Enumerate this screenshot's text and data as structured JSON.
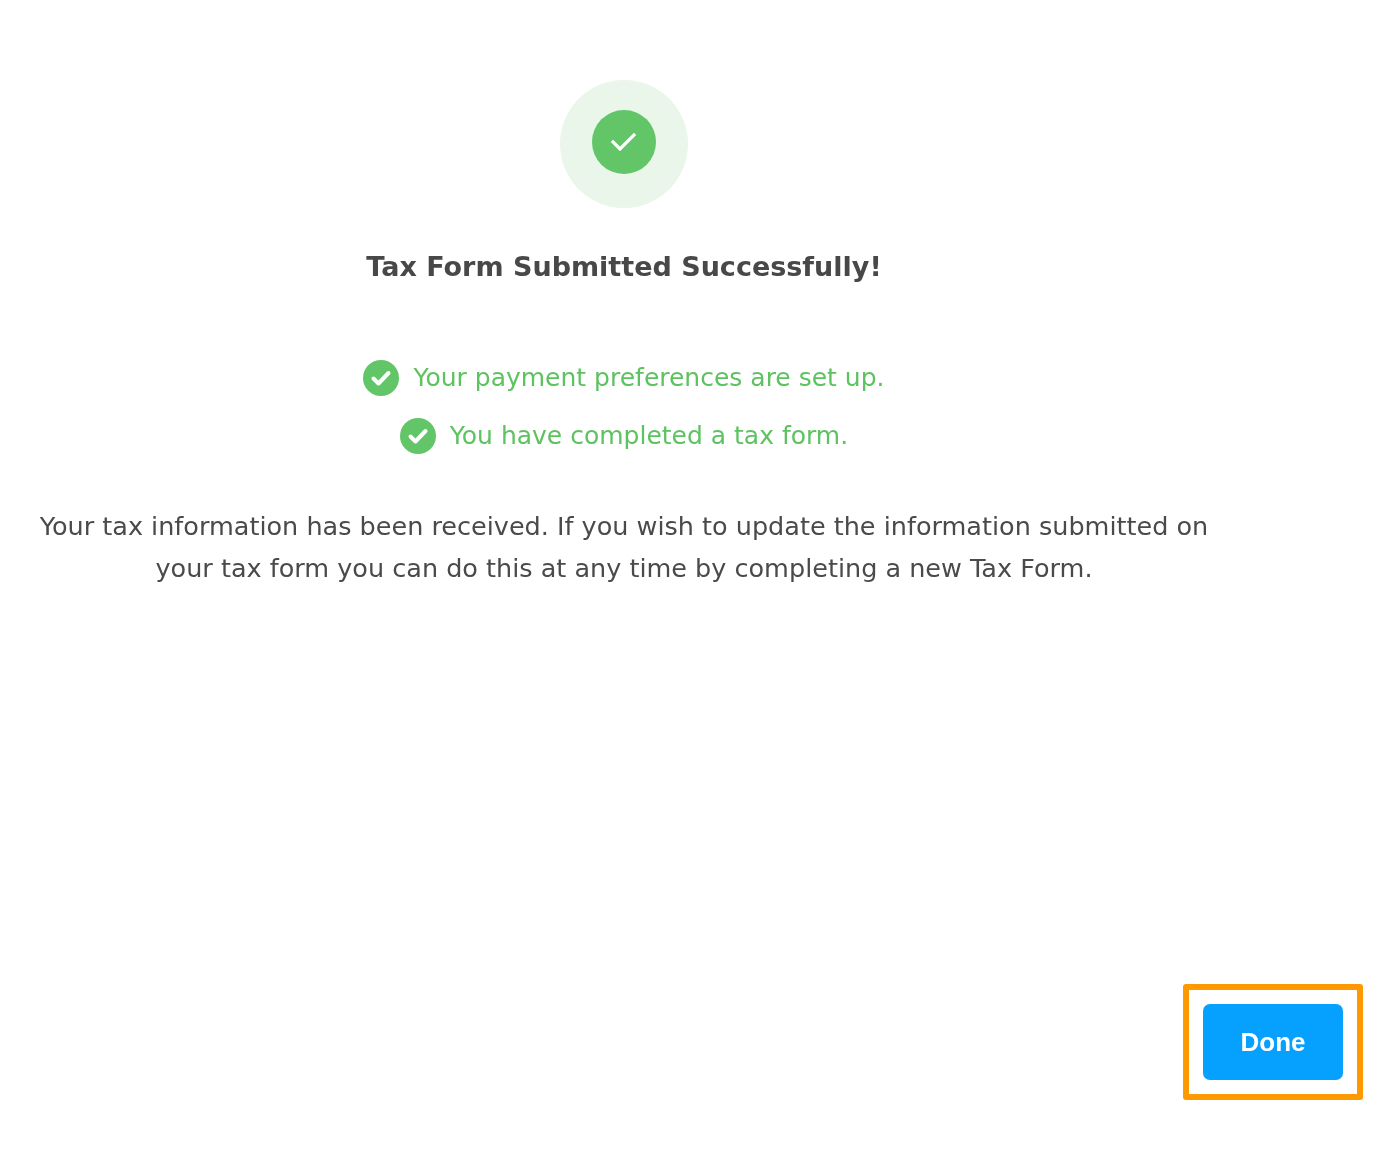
{
  "title": "Tax Form Submitted Successfully!",
  "checklist": [
    {
      "text": "Your payment preferences are set up.",
      "done": true
    },
    {
      "text": "You have completed a tax form.",
      "done": true
    }
  ],
  "message": "Your tax information has been received. If you wish to update the information submitted on your tax form you can do this at any time by completing a new Tax Form.",
  "done_button": {
    "label": "Done",
    "highlighted": true
  }
}
